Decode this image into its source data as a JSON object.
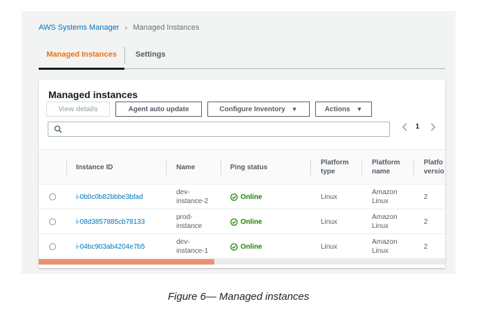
{
  "breadcrumb": {
    "root": "AWS Systems Manager",
    "separator": "›",
    "current": "Managed Instances"
  },
  "tabs": [
    {
      "label": "Managed Instances",
      "active": true
    },
    {
      "label": "Settings",
      "active": false
    }
  ],
  "panel": {
    "title": "Managed instances",
    "buttons": {
      "view_details": "View details",
      "agent_auto_update": "Agent auto update",
      "configure_inventory": "Configure Inventory",
      "actions": "Actions"
    },
    "search": {
      "placeholder": "",
      "icon": "search-icon"
    },
    "pagination": {
      "prev": "‹",
      "page": "1",
      "next": "›"
    }
  },
  "table": {
    "columns": [
      "Instance ID",
      "Name",
      "Ping status",
      "Platform type",
      "Platform name",
      "Platform version"
    ],
    "column_display": {
      "platform_type": [
        "Platform",
        "type"
      ],
      "platform_name": [
        "Platform",
        "name"
      ],
      "platform_version": [
        "Platfo",
        "versio"
      ]
    },
    "rows": [
      {
        "instance_id": "i-0b0c0b82bbbe3bfad",
        "name": [
          "dev-",
          "instance-2"
        ],
        "ping_status": "Online",
        "platform_type": "Linux",
        "platform_name": [
          "Amazon",
          "Linux"
        ],
        "platform_version": "2"
      },
      {
        "instance_id": "i-08d3857885cb78133",
        "name": [
          "prod-",
          "instance"
        ],
        "ping_status": "Online",
        "platform_type": "Linux",
        "platform_name": [
          "Amazon",
          "Linux"
        ],
        "platform_version": "2"
      },
      {
        "instance_id": "i-04bc903ab4204e7b5",
        "name": [
          "dev-",
          "instance-1"
        ],
        "ping_status": "Online",
        "platform_type": "Linux",
        "platform_name": [
          "Amazon",
          "Linux"
        ],
        "platform_version": "2"
      }
    ]
  },
  "colors": {
    "link": "#0073bb",
    "active_tab": "#ec7211",
    "online": "#1d8102",
    "scroll_thumb": "#ec9170"
  },
  "caption": "Figure 6— Managed instances"
}
